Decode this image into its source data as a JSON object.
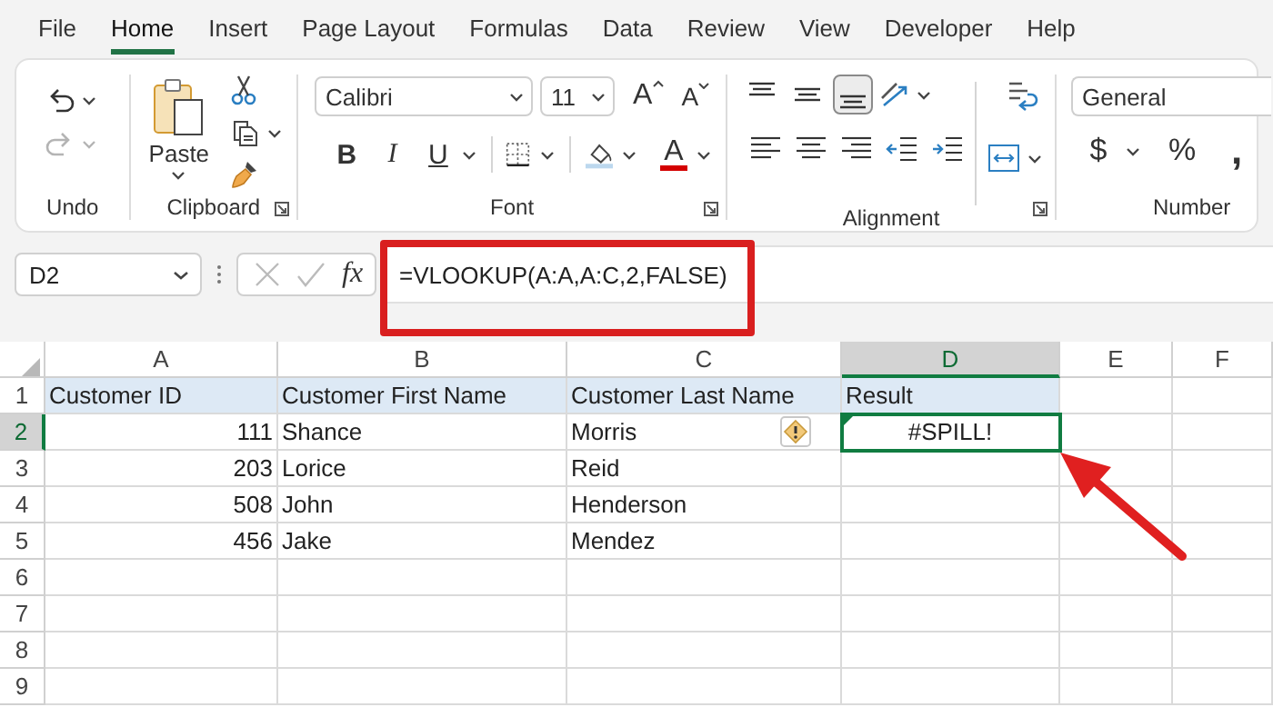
{
  "menu_tabs": [
    {
      "label": "File",
      "selected": false
    },
    {
      "label": "Home",
      "selected": true
    },
    {
      "label": "Insert",
      "selected": false
    },
    {
      "label": "Page Layout",
      "selected": false
    },
    {
      "label": "Formulas",
      "selected": false
    },
    {
      "label": "Data",
      "selected": false
    },
    {
      "label": "Review",
      "selected": false
    },
    {
      "label": "View",
      "selected": false
    },
    {
      "label": "Developer",
      "selected": false
    },
    {
      "label": "Help",
      "selected": false
    }
  ],
  "ribbon": {
    "undo": {
      "label": "Undo",
      "redo_disabled": true
    },
    "clipboard": {
      "label": "Clipboard",
      "paste": "Paste"
    },
    "font": {
      "label": "Font",
      "name": "Calibri",
      "size": "11",
      "grow": "A",
      "shrink": "A",
      "bold": "B",
      "italic": "I",
      "underline": "U",
      "color_letter": "A"
    },
    "alignment": {
      "label": "Alignment",
      "vertical_alignment": [
        {
          "kind": "top",
          "selected": false
        },
        {
          "kind": "middle",
          "selected": false
        },
        {
          "kind": "bottom",
          "selected": true
        }
      ]
    },
    "number": {
      "label": "Number",
      "format": "General",
      "currency": "$",
      "percent": "%",
      "comma": ","
    }
  },
  "formula_bar": {
    "name_box": "D2",
    "function_symbol": "fx",
    "formula": "=VLOOKUP(A:A,A:C,2,FALSE)"
  },
  "sheet": {
    "columns": [
      {
        "label": "A",
        "selected": false
      },
      {
        "label": "B",
        "selected": false
      },
      {
        "label": "C",
        "selected": false
      },
      {
        "label": "D",
        "selected": true
      },
      {
        "label": "E",
        "selected": false
      },
      {
        "label": "F",
        "selected": false
      }
    ],
    "rows": [
      {
        "number": "1",
        "selected": false,
        "highlighted": true,
        "cells": [
          {
            "text": "Customer ID",
            "kind": "text",
            "selected": false
          },
          {
            "text": "Customer First Name",
            "kind": "text",
            "selected": false
          },
          {
            "text": "Customer Last Name",
            "kind": "text",
            "selected": false
          },
          {
            "text": "Result",
            "kind": "text",
            "selected": false
          }
        ]
      },
      {
        "number": "2",
        "selected": true,
        "highlighted": false,
        "cells": [
          {
            "text": "111",
            "kind": "number",
            "selected": false
          },
          {
            "text": "Shance",
            "kind": "text",
            "selected": false
          },
          {
            "text": "Morris",
            "kind": "text",
            "selected": false
          },
          {
            "text": "#SPILL!",
            "kind": "error",
            "selected": true,
            "error_indicator": true
          }
        ]
      },
      {
        "number": "3",
        "selected": false,
        "highlighted": false,
        "cells": [
          {
            "text": "203",
            "kind": "number",
            "selected": false
          },
          {
            "text": "Lorice",
            "kind": "text",
            "selected": false
          },
          {
            "text": "Reid",
            "kind": "text",
            "selected": false
          }
        ]
      },
      {
        "number": "4",
        "selected": false,
        "highlighted": false,
        "cells": [
          {
            "text": "508",
            "kind": "number",
            "selected": false
          },
          {
            "text": "John",
            "kind": "text",
            "selected": false
          },
          {
            "text": "Henderson",
            "kind": "text",
            "selected": false
          }
        ]
      },
      {
        "number": "5",
        "selected": false,
        "highlighted": false,
        "cells": [
          {
            "text": "456",
            "kind": "number",
            "selected": false
          },
          {
            "text": "Jake",
            "kind": "text",
            "selected": false
          },
          {
            "text": "Mendez",
            "kind": "text",
            "selected": false
          }
        ]
      },
      {
        "number": "6",
        "selected": false,
        "highlighted": false
      },
      {
        "number": "7",
        "selected": false,
        "highlighted": false
      },
      {
        "number": "8",
        "selected": false,
        "highlighted": false
      },
      {
        "number": "9",
        "selected": false,
        "highlighted": false
      }
    ]
  },
  "annotations": {
    "highlight_box": true,
    "arrow": true
  }
}
